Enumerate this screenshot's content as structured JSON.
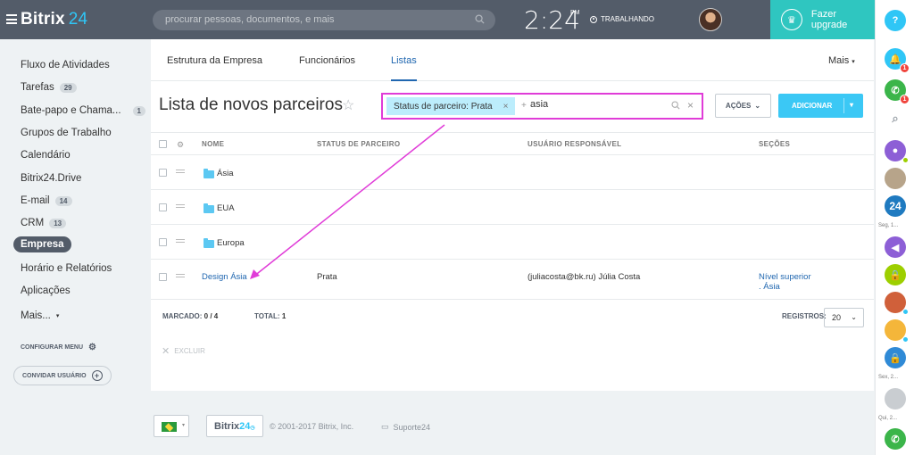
{
  "header": {
    "logo_main": "Bitrix",
    "logo_num": "24",
    "search_placeholder": "procurar pessoas, documentos, e mais",
    "time": "2:24",
    "ampm": "PM",
    "work_status": "TRABALHANDO",
    "upgrade_label": "Fazer upgrade"
  },
  "sidebar": {
    "items": [
      {
        "label": "Fluxo de Atividades",
        "count": ""
      },
      {
        "label": "Tarefas",
        "count": "29"
      },
      {
        "label": "Bate-papo e Chama...",
        "count": "1"
      },
      {
        "label": "Grupos de Trabalho",
        "count": ""
      },
      {
        "label": "Calendário",
        "count": ""
      },
      {
        "label": "Bitrix24.Drive",
        "count": ""
      },
      {
        "label": "E-mail",
        "count": "14"
      },
      {
        "label": "CRM",
        "count": "13"
      },
      {
        "label": "Empresa",
        "count": ""
      },
      {
        "label": "Horário e Relatórios",
        "count": ""
      },
      {
        "label": "Aplicações",
        "count": ""
      },
      {
        "label": "Mais...",
        "count": ""
      }
    ],
    "configure_label": "CONFIGURAR MENU",
    "invite_label": "CONVIDAR USUÁRIO"
  },
  "tabs": [
    "Estrutura da Empresa",
    "Funcionários",
    "Listas"
  ],
  "more_tab": "Mais",
  "page": {
    "title": "Lista de novos parceiros",
    "filter_chip": "Status de parceiro: Prata",
    "filter_query": "asia",
    "actions_label": "AÇÕES",
    "add_label": "ADICIONAR"
  },
  "grid": {
    "headers": [
      "NOME",
      "STATUS DE PARCEIRO",
      "USUÁRIO RESPONSÁVEL",
      "SEÇÕES"
    ],
    "folders": [
      "Ásia",
      "EUA",
      "Europa"
    ],
    "item": {
      "name": "Design Ásia",
      "status": "Prata",
      "user": "(juliacosta@bk.ru) Júlia Costa",
      "section_line1": "Nível superior",
      "section_line2": ". Ásia"
    },
    "footer": {
      "marked_label": "MARCADO:",
      "marked_value": "0 / 4",
      "total_label": "TOTAL:",
      "total_value": "1",
      "records_label": "REGISTROS:",
      "records_value": "20"
    },
    "delete_label": "EXCLUIR"
  },
  "footer": {
    "badge_main": "Bitrix",
    "badge_num": "24",
    "copyright": "© 2001-2017 Bitrix, Inc.",
    "support": "Suporte24"
  },
  "rightbar": {
    "help": "?",
    "notif_count": "1",
    "chat_count": "1",
    "b24_label": "24",
    "caption1": "Seg, 1...",
    "caption2": "Sex, 2...",
    "caption3": "Qui, 2..."
  },
  "colors": {
    "header": "#535c69",
    "accent": "#2fc6f6",
    "upgrade": "#2fc6c0",
    "link": "#2067b0",
    "highlight": "#e03cd8"
  }
}
